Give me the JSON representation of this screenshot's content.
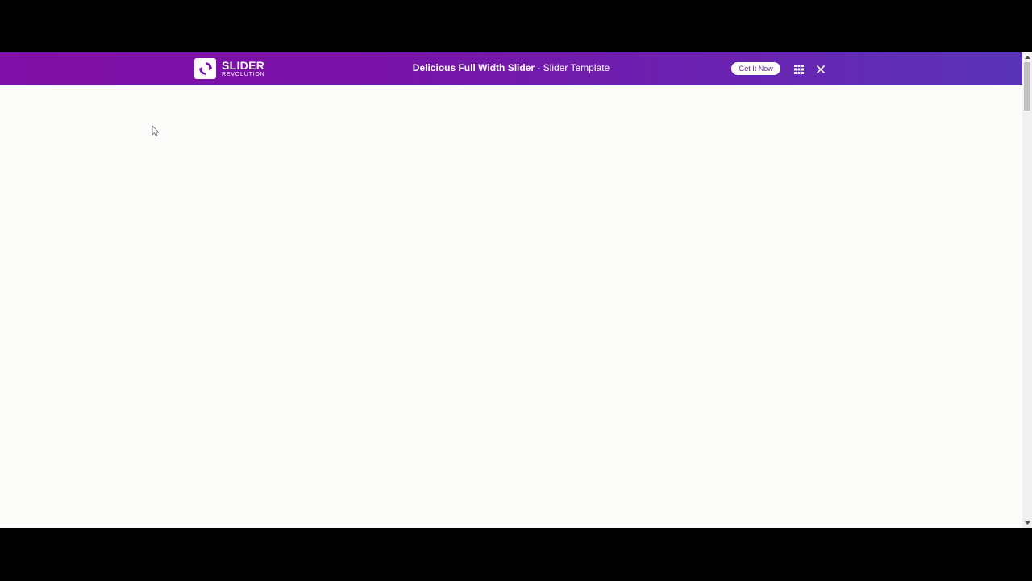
{
  "topbar": {
    "logo_main": "SLIDER",
    "logo_sub": "REVOLUTION",
    "title_bold": "Delicious Full Width Slider",
    "title_rest": " - Slider Template",
    "cta_label": "Get It Now",
    "icons": {
      "logo": "slider-revolution-logo",
      "grid": "grid-icon",
      "close": "close-icon"
    }
  },
  "colors": {
    "bar_start": "#7f0fa6",
    "bar_end": "#5a34b8",
    "page_bg": "#fcfcfa",
    "cta_text": "#5b2a8a"
  }
}
